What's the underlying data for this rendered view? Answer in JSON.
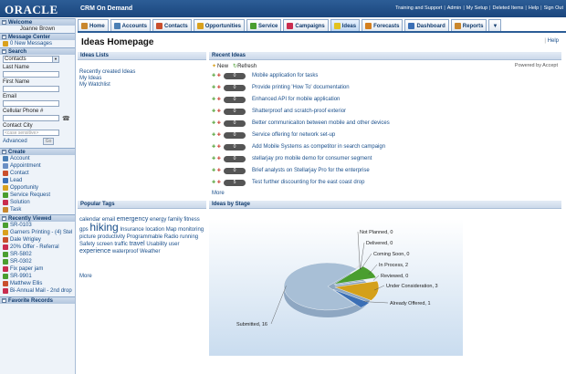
{
  "header": {
    "brand": "ORACLE",
    "product": "CRM On Demand",
    "links": [
      "Training and Support",
      "Admin",
      "My Setup",
      "Deleted Items",
      "Help",
      "Sign Out"
    ]
  },
  "tabs": [
    {
      "label": "Home",
      "icon": "home-icon",
      "color": "#c9872d"
    },
    {
      "label": "Accounts",
      "icon": "accounts-icon",
      "color": "#4a7fb5"
    },
    {
      "label": "Contacts",
      "icon": "contacts-icon",
      "color": "#c94f2d"
    },
    {
      "label": "Opportunities",
      "icon": "opportunities-icon",
      "color": "#d9a11e"
    },
    {
      "label": "Service",
      "icon": "service-icon",
      "color": "#4a9e2f"
    },
    {
      "label": "Campaigns",
      "icon": "campaigns-icon",
      "color": "#c92d4f"
    },
    {
      "label": "Ideas",
      "icon": "ideas-icon",
      "color": "#e2c21e"
    },
    {
      "label": "Forecasts",
      "icon": "forecasts-icon",
      "color": "#d47f1e"
    },
    {
      "label": "Dashboard",
      "icon": "dashboard-icon",
      "color": "#3b6fb5"
    },
    {
      "label": "Reports",
      "icon": "reports-icon",
      "color": "#c9872d"
    }
  ],
  "sidebar": {
    "welcome": {
      "title": "Welcome",
      "user": "Joanne Brown"
    },
    "message_center": {
      "title": "Message Center",
      "new_messages": "0 New Messages"
    },
    "search": {
      "title": "Search",
      "type_selected": "Contacts",
      "fields": [
        {
          "label": "Last Name",
          "placeholder": ""
        },
        {
          "label": "First Name",
          "placeholder": ""
        },
        {
          "label": "Email",
          "placeholder": ""
        },
        {
          "label": "Cellular Phone #",
          "placeholder": ""
        },
        {
          "label": "Contact City",
          "placeholder": "<case sensitive>"
        }
      ],
      "advanced": "Advanced",
      "go": "Go"
    },
    "create": {
      "title": "Create",
      "items": [
        {
          "label": "Account",
          "icon": "account-icon",
          "color": "#4a7fb5"
        },
        {
          "label": "Appointment",
          "icon": "appointment-icon",
          "color": "#6a8fc4"
        },
        {
          "label": "Contact",
          "icon": "contact-icon",
          "color": "#c94f2d"
        },
        {
          "label": "Lead",
          "icon": "lead-icon",
          "color": "#3b6fb5"
        },
        {
          "label": "Opportunity",
          "icon": "opportunity-icon",
          "color": "#d9a11e"
        },
        {
          "label": "Service Request",
          "icon": "service-request-icon",
          "color": "#4a9e2f"
        },
        {
          "label": "Solution",
          "icon": "solution-icon",
          "color": "#c92d4f"
        },
        {
          "label": "Task",
          "icon": "task-icon",
          "color": "#c9872d"
        }
      ]
    },
    "recently_viewed": {
      "title": "Recently Viewed",
      "items": [
        {
          "label": "SR-0103",
          "icon": "service-request-icon",
          "color": "#4a9e2f"
        },
        {
          "label": "Garners Printing - (4) Stel",
          "icon": "opportunity-icon",
          "color": "#d9a11e"
        },
        {
          "label": "Dale Wrigley",
          "icon": "contact-icon",
          "color": "#c94f2d"
        },
        {
          "label": "20% Offer - Referral",
          "icon": "campaign-icon",
          "color": "#c92d4f"
        },
        {
          "label": "SR-5802",
          "icon": "service-request-icon",
          "color": "#4a9e2f"
        },
        {
          "label": "SR-0302",
          "icon": "service-request-icon",
          "color": "#4a9e2f"
        },
        {
          "label": "Fix paper jam",
          "icon": "solution-icon",
          "color": "#c92d4f"
        },
        {
          "label": "SR-9901",
          "icon": "service-request-icon",
          "color": "#4a9e2f"
        },
        {
          "label": "Matthew Ellis",
          "icon": "contact-icon",
          "color": "#c94f2d"
        },
        {
          "label": "Bi-Annual Mail - 2nd drop",
          "icon": "campaign-icon",
          "color": "#c92d4f"
        }
      ]
    },
    "favorite_records": {
      "title": "Favorite Records"
    }
  },
  "main": {
    "page_title": "Ideas Homepage",
    "help": "Help",
    "ideas_lists": {
      "title": "Ideas Lists",
      "links": [
        "Recently created Ideas",
        "My Ideas",
        "My Watchlist"
      ]
    },
    "recent_ideas": {
      "title": "Recent Ideas",
      "new_label": "New",
      "refresh_label": "Refresh",
      "powered_by": "Powered by Accept",
      "items": [
        {
          "score": "0",
          "title": "Mobile application for tasks"
        },
        {
          "score": "0",
          "title": "Provide printing 'How To' documentation"
        },
        {
          "score": "0",
          "title": "Enhanced API for mobile application"
        },
        {
          "score": "0",
          "title": "Shatterproof and scratch-proof exterior"
        },
        {
          "score": "0",
          "title": "Better communicaiton between mobile and other devices"
        },
        {
          "score": "0",
          "title": "Service offering for network set-up"
        },
        {
          "score": "0",
          "title": "Add Mobile Systems as competitor in search campaign"
        },
        {
          "score": "0",
          "title": "stellarjay pro mobile demo for consumer segment"
        },
        {
          "score": "0",
          "title": "Brief analysts on Stellarjay Pro for the enterprise"
        },
        {
          "score": "5",
          "title": "Test further discounting for the east coast drop"
        }
      ],
      "more": "More"
    },
    "popular_tags": {
      "title": "Popular Tags",
      "tags": [
        {
          "text": "calendar",
          "size": 6
        },
        {
          "text": "email",
          "size": 6
        },
        {
          "text": "emergency",
          "size": 7
        },
        {
          "text": "energy",
          "size": 6
        },
        {
          "text": "family",
          "size": 6
        },
        {
          "text": "fitness",
          "size": 6
        },
        {
          "text": "gps",
          "size": 6
        },
        {
          "text": "hiking",
          "size": 12
        },
        {
          "text": "Insurance",
          "size": 6
        },
        {
          "text": "location",
          "size": 6
        },
        {
          "text": "Map",
          "size": 6
        },
        {
          "text": "monitoring",
          "size": 6
        },
        {
          "text": "picture",
          "size": 6
        },
        {
          "text": "productivity",
          "size": 6
        },
        {
          "text": "Programmable",
          "size": 6
        },
        {
          "text": "Radio",
          "size": 6
        },
        {
          "text": "running",
          "size": 6
        },
        {
          "text": "Safety",
          "size": 6
        },
        {
          "text": "screen",
          "size": 6
        },
        {
          "text": "traffic",
          "size": 6
        },
        {
          "text": "travel",
          "size": 7
        },
        {
          "text": "Usability",
          "size": 6
        },
        {
          "text": "user",
          "size": 6
        },
        {
          "text": "experience",
          "size": 7
        },
        {
          "text": "waterproof",
          "size": 6
        },
        {
          "text": "Weather",
          "size": 6
        }
      ],
      "more": "More"
    },
    "ideas_by_stage": {
      "title": "Ideas by Stage",
      "chart_data": {
        "type": "pie",
        "categories": [
          "Not Planned",
          "Delivered",
          "Coming Soon",
          "In Process",
          "Reviewed",
          "Under Consideration",
          "Already Offered",
          "Submitted"
        ],
        "values": [
          0,
          0,
          0,
          2,
          0,
          3,
          1,
          16
        ],
        "labels": [
          "Not Planned, 0",
          "Delivered, 0",
          "Coming Soon, 0",
          "In Process, 2",
          "Reviewed, 0",
          "Under Consideration, 3",
          "Already Offered, 1",
          "Submitted, 16"
        ],
        "colors": [
          "#7a1f1f",
          "#3b3b8f",
          "#1f8f8a",
          "#4a9e2f",
          "#7c3f8f",
          "#d4a01a",
          "#3b6fb5",
          "#a8bfd6"
        ]
      }
    }
  }
}
